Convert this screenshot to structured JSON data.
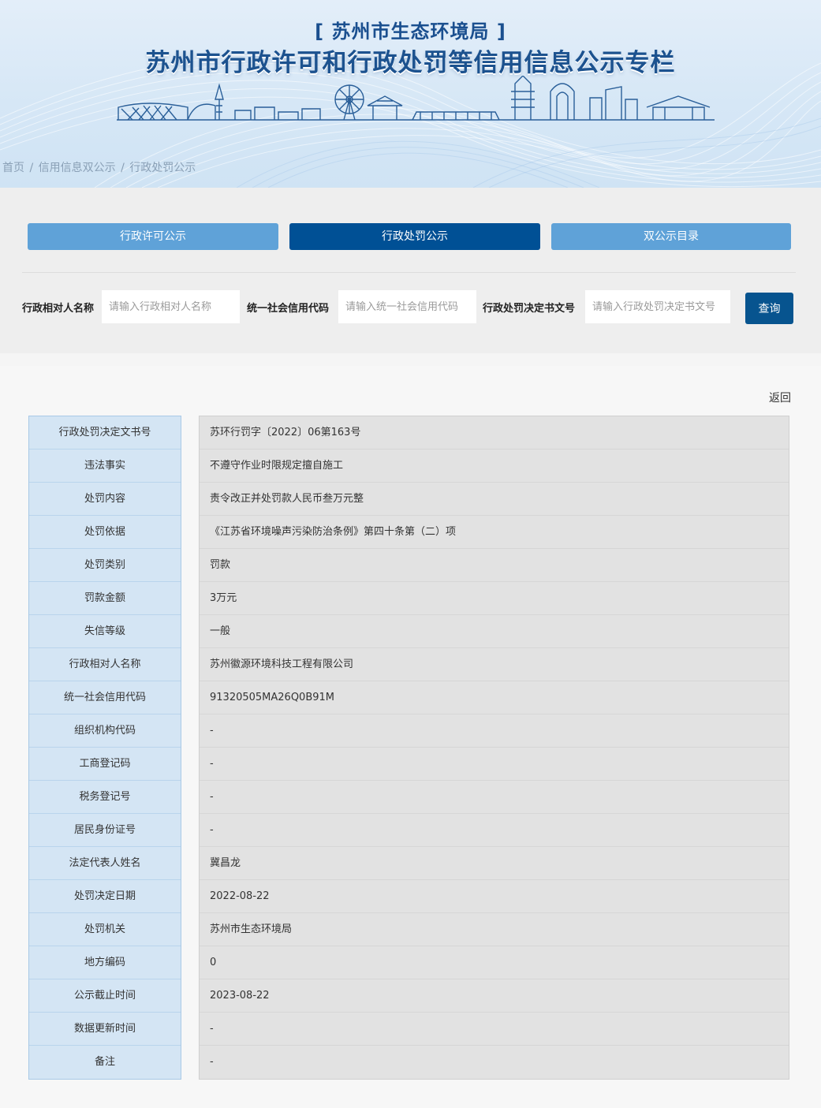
{
  "header": {
    "agency": "[ 苏州市生态环境局 ]",
    "title": "苏州市行政许可和行政处罚等信用信息公示专栏"
  },
  "breadcrumb": [
    "首页",
    "/",
    "信用信息双公示",
    "/",
    "行政处罚公示"
  ],
  "nav": {
    "tabs": [
      {
        "label": "行政许可公示"
      },
      {
        "label": "行政处罚公示",
        "active": true
      },
      {
        "label": "双公示目录"
      }
    ]
  },
  "search": {
    "fields": [
      {
        "label": "行政相对人名称",
        "placeholder": "请输入行政相对人名称",
        "value": ""
      },
      {
        "label": "统一社会信用代码",
        "placeholder": "请输入统一社会信用代码",
        "value": ""
      },
      {
        "label": "行政处罚决定书文号",
        "placeholder": "请输入行政处罚决定书文号",
        "value": ""
      }
    ],
    "query_label": "查询"
  },
  "detail": {
    "back_label": "返回",
    "rows": [
      {
        "label": "行政处罚决定文书号",
        "value": "苏环行罚字〔2022〕06第163号"
      },
      {
        "label": "违法事实",
        "value": "不遵守作业时限规定擅自施工"
      },
      {
        "label": "处罚内容",
        "value": "责令改正并处罚款人民币叁万元整"
      },
      {
        "label": "处罚依据",
        "value": "《江苏省环境噪声污染防治条例》第四十条第（二）项"
      },
      {
        "label": "处罚类别",
        "value": "罚款"
      },
      {
        "label": "罚款金额",
        "value": "3万元"
      },
      {
        "label": "失信等级",
        "value": "一般"
      },
      {
        "label": "行政相对人名称",
        "value": "苏州徽源环境科技工程有限公司"
      },
      {
        "label": "统一社会信用代码",
        "value": "91320505MA26Q0B91M"
      },
      {
        "label": "组织机构代码",
        "value": "-"
      },
      {
        "label": "工商登记码",
        "value": "-"
      },
      {
        "label": "税务登记号",
        "value": "-"
      },
      {
        "label": "居民身份证号",
        "value": "-"
      },
      {
        "label": "法定代表人姓名",
        "value": "冀昌龙"
      },
      {
        "label": "处罚决定日期",
        "value": "2022-08-22"
      },
      {
        "label": "处罚机关",
        "value": "苏州市生态环境局"
      },
      {
        "label": "地方编码",
        "value": "0"
      },
      {
        "label": "公示截止时间",
        "value": "2023-08-22"
      },
      {
        "label": "数据更新时间",
        "value": "-"
      },
      {
        "label": "备注",
        "value": "-"
      }
    ]
  },
  "colors": {
    "title_blue": "#1c528f",
    "nav_inactive": "#5fa2d8",
    "nav_active": "#005095",
    "query_button": "#07548f",
    "label_bg": "#d4e5f4",
    "value_bg": "#e2e2e2"
  }
}
